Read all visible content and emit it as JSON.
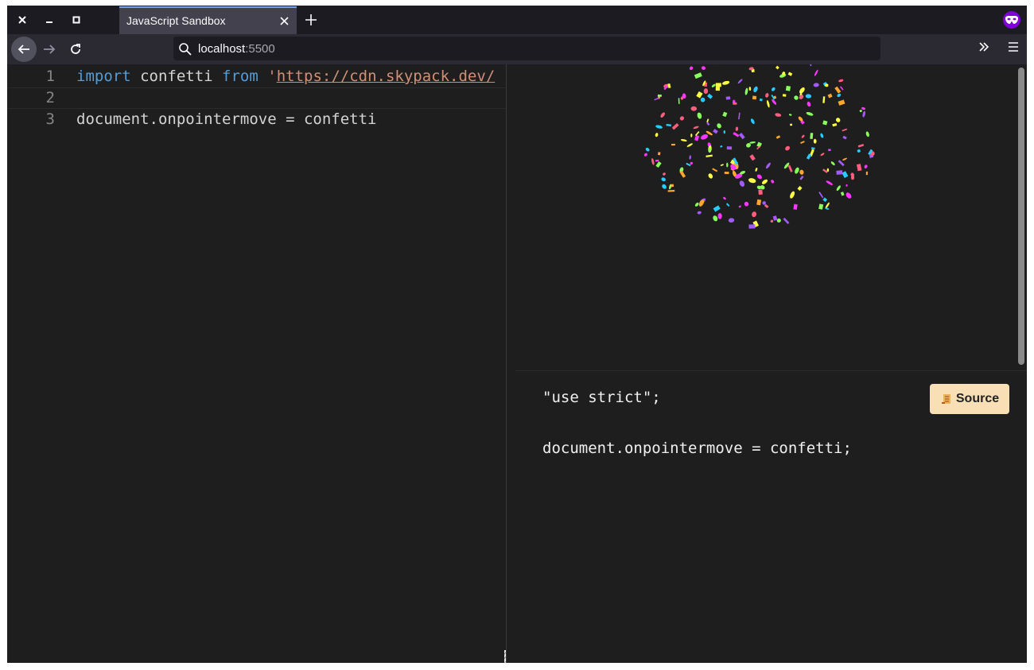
{
  "window": {
    "close_icon": "close-icon",
    "minimize_icon": "minimize-icon",
    "maximize_icon": "maximize-icon"
  },
  "tab": {
    "title": "JavaScript Sandbox",
    "close_icon": "close-icon",
    "new_tab_icon": "plus-icon"
  },
  "private_icon": "private-browsing-mask-icon",
  "nav": {
    "back_icon": "arrow-left-icon",
    "forward_icon": "arrow-right-icon",
    "reload_icon": "reload-icon",
    "url_host": "localhost",
    "url_port": ":5500",
    "search_icon": "search-icon",
    "overflow_icon": "chevron-double-right-icon",
    "menu_icon": "hamburger-menu-icon"
  },
  "editor": {
    "lines": [
      {
        "number": "1",
        "kw1": "import",
        "text1": " confetti ",
        "kw2": "from",
        "text2": " '",
        "url": "https://cdn.skypack.dev/"
      },
      {
        "number": "2"
      },
      {
        "number": "3",
        "text": "document.onpointermove = confetti"
      }
    ]
  },
  "output": {
    "line1": "\"use strict\";",
    "line2": "document.onpointermove = confetti;",
    "source_button": "Source",
    "source_icon": "scroll-icon"
  },
  "colors": {
    "keyword": "#569cd6",
    "string": "#ce9178",
    "accent_tab": "#7a9cf2",
    "private": "#8000d7",
    "source_button": "#f8dfb5"
  }
}
